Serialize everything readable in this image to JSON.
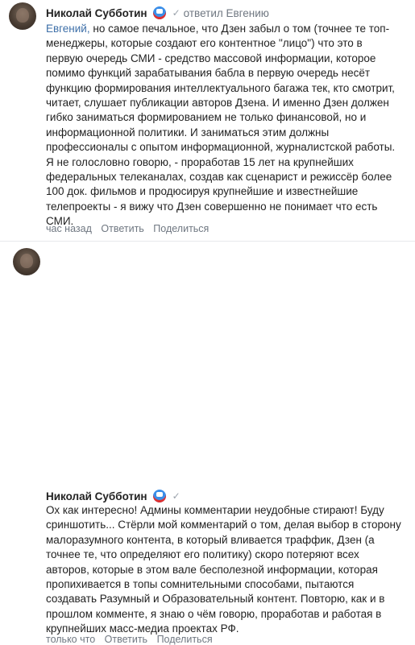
{
  "comments": [
    {
      "author": "Николай Субботин",
      "replied": "ответил Евгению",
      "mention": "Евгений,",
      "lines": [
        "но самое печальное, что Дзен забыл о том (точнее те топ-",
        "менеджеры, которые создают его контентное \"лицо\") что это в",
        "первую очередь СМИ - средство массовой информации, которое",
        "помимо функций зарабатывания бабла в первую очередь несёт",
        "функцию формирования интеллектуального багажа тек, кто смотрит,",
        "читает, слушает публикации авторов Дзена. И именно Дзен должен",
        "гибко заниматься формированием не только финансовой, но и",
        "информационной политики. И заниматься этим должны",
        "профессионалы с опытом информационной, журналистской работы.",
        "Я не голословно говорю, - проработав 15 лет на крупнейших",
        "федеральных телеканалах, создав как сценарист и режиссёр более",
        "100 док. фильмов и продюсируя крупнейшие и известнейшие",
        "телепроекты - я вижу что Дзен совершенно не понимает что есть",
        "СМИ."
      ],
      "time": "час назад",
      "reply": "Ответить",
      "share": "Поделиться"
    },
    {
      "author": "Николай Субботин",
      "lines": [
        "Ох как интересно! Админы комментарии неудобные стирают! Буду",
        "сриншотить... Стёрли мой комментарий о том, делая выбор в сторону",
        "малоразумного контента, в который вливается траффик, Дзен (а",
        "точнее те, что определяют его политику) скоро потеряют всех",
        "авторов, которые в этом вале бесполезной информации, которая",
        "пропихивается в топы сомнительными способами, пытаются",
        "создавать Разумный и Образовательный контент. Повторю, как и в",
        "прошлом комменте, я знаю о чём говорю, проработав и работая в",
        "крупнейших масс-медиа проектах РФ."
      ],
      "time": "только что",
      "reply": "Ответить",
      "share": "Поделиться"
    }
  ]
}
